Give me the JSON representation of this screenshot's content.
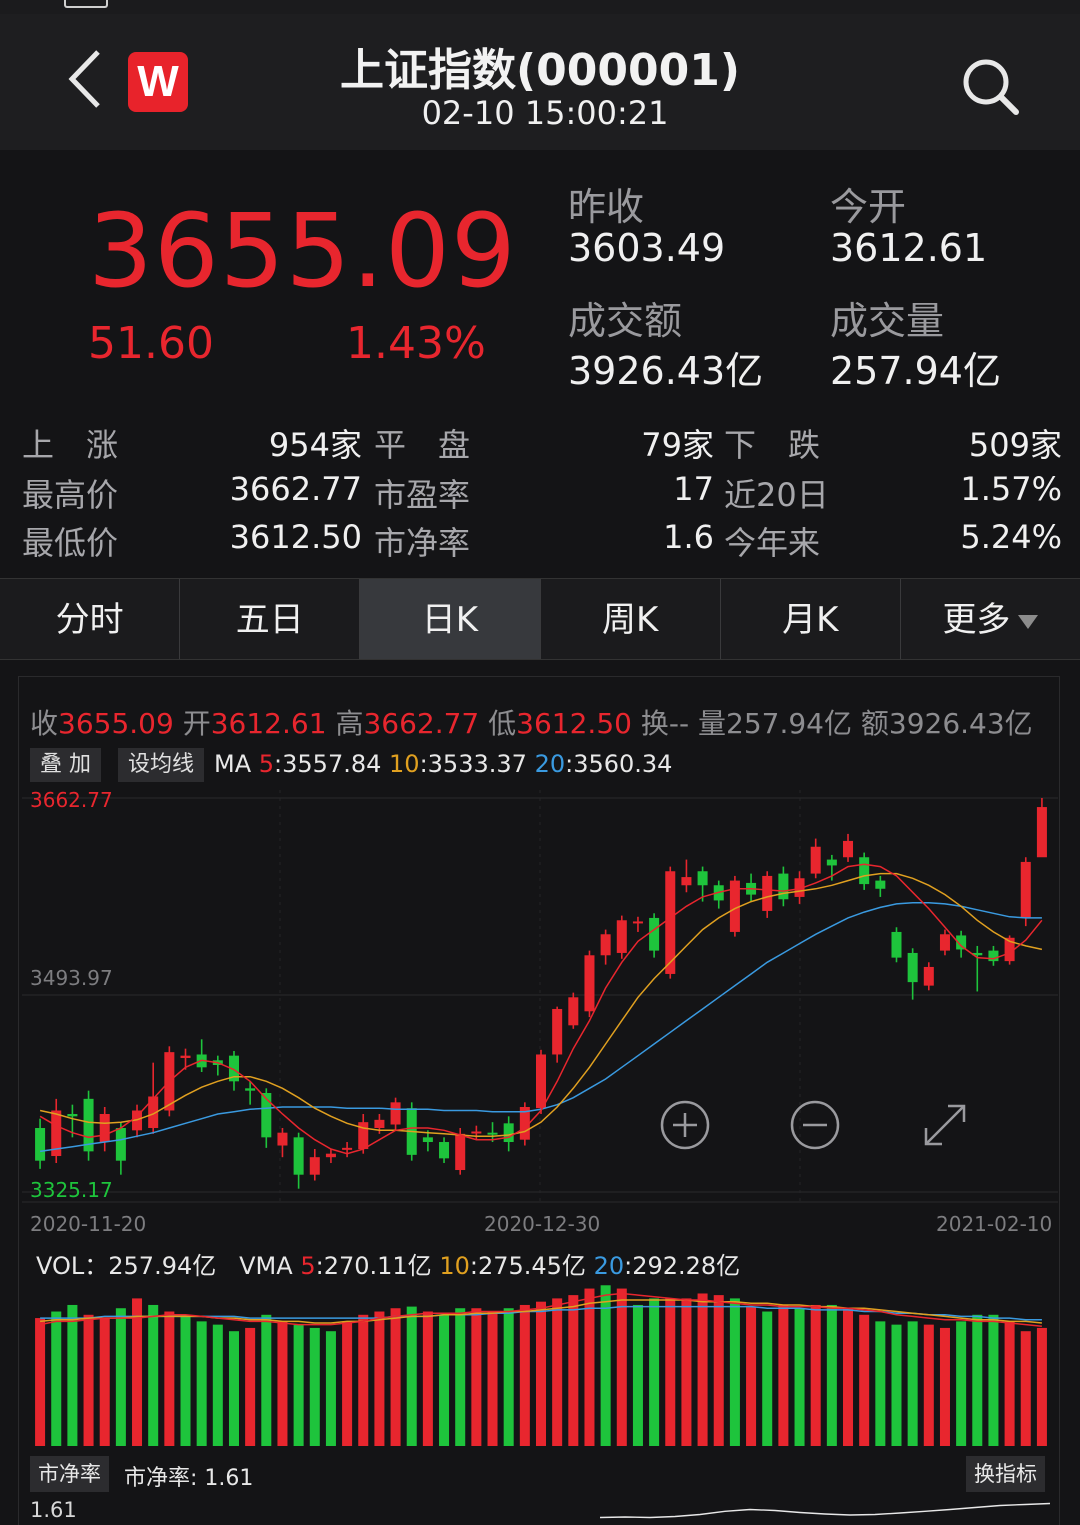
{
  "header": {
    "back_icon": "chevron-left-icon",
    "logo_text": "W",
    "title": "上证指数(000001)",
    "time": "02-10 15:00:21",
    "search_icon": "search-icon"
  },
  "quote": {
    "price": "3655.09",
    "change": "51.60",
    "change_pct": "1.43%",
    "prev_close_label": "昨收",
    "prev_close": "3603.49",
    "open_label": "今开",
    "open": "3612.61",
    "amount_label": "成交额",
    "amount": "3926.43亿",
    "volume_label": "成交量",
    "volume": "257.94亿",
    "up_color": "#e8262e"
  },
  "stats": [
    {
      "l1": "上　涨",
      "v1": "954家",
      "l2": "平　盘",
      "v2": "79家",
      "l3": "下　跌",
      "v3": "509家"
    },
    {
      "l1": "最高价",
      "v1": "3662.77",
      "l2": "市盈率",
      "v2": "17",
      "l3": "近20日",
      "v3": "1.57%"
    },
    {
      "l1": "最低价",
      "v1": "3612.50",
      "l2": "市净率",
      "v2": "1.6",
      "l3": "今年来",
      "v3": "5.24%"
    }
  ],
  "tabs": [
    "分时",
    "五日",
    "日K",
    "周K",
    "月K",
    "更多"
  ],
  "active_tab": "日K",
  "kline": {
    "ohlc": {
      "close_label": "收",
      "close": "3655.09",
      "open_label": "开",
      "open": "3612.61",
      "high_label": "高",
      "high": "3662.77",
      "low_label": "低",
      "low": "3612.50",
      "turnover_label": "换--",
      "vol_label": "量257.94亿",
      "amt_label": "额3926.43亿"
    },
    "overlay_btn": "叠 加",
    "ma_btn": "设均线",
    "ma_prefix": "MA",
    "ma5_k": "5",
    "ma5_v": ":3557.84",
    "ma10_k": "10",
    "ma10_v": ":3533.37",
    "ma20_k": "20",
    "ma20_v": ":3560.34",
    "y_high": "3662.77",
    "y_mid": "3493.97",
    "y_low": "3325.17",
    "dates": [
      "2020-11-20",
      "2020-12-30",
      "2021-02-10"
    ],
    "zoom_in_icon": "zoom-in-icon",
    "zoom_out_icon": "zoom-out-icon",
    "fullscreen_icon": "expand-icon"
  },
  "volume": {
    "prefix": "VOL：",
    "value": "257.94亿",
    "vma": "VMA",
    "vma5_k": "5",
    "vma5_v": ":270.11亿",
    "vma10_k": "10",
    "vma10_v": ":275.45亿",
    "vma20_k": "20",
    "vma20_v": ":292.28亿"
  },
  "indicator": {
    "chip": "市净率",
    "label": "市净率: 1.61",
    "switch_btn": "换指标",
    "axis": "1.61"
  },
  "colors": {
    "up": "#e8262e",
    "down": "#1ec43c",
    "ma5": "#e8262e",
    "ma10": "#e0a020",
    "ma20": "#3a9ae0"
  },
  "chart_data": {
    "type": "candlestick",
    "ylim": [
      3325.17,
      3662.77
    ],
    "candles": [
      {
        "o": 3380,
        "c": 3352,
        "h": 3388,
        "l": 3345
      },
      {
        "o": 3356,
        "c": 3395,
        "h": 3405,
        "l": 3350
      },
      {
        "o": 3392,
        "c": 3390,
        "h": 3400,
        "l": 3372
      },
      {
        "o": 3405,
        "c": 3360,
        "h": 3412,
        "l": 3352
      },
      {
        "o": 3368,
        "c": 3392,
        "h": 3398,
        "l": 3360
      },
      {
        "o": 3380,
        "c": 3352,
        "h": 3385,
        "l": 3340
      },
      {
        "o": 3378,
        "c": 3395,
        "h": 3400,
        "l": 3372
      },
      {
        "o": 3380,
        "c": 3407,
        "h": 3436,
        "l": 3375
      },
      {
        "o": 3395,
        "c": 3445,
        "h": 3450,
        "l": 3390
      },
      {
        "o": 3440,
        "c": 3442,
        "h": 3448,
        "l": 3430
      },
      {
        "o": 3443,
        "c": 3432,
        "h": 3456,
        "l": 3428
      },
      {
        "o": 3438,
        "c": 3434,
        "h": 3442,
        "l": 3425
      },
      {
        "o": 3442,
        "c": 3420,
        "h": 3446,
        "l": 3412
      },
      {
        "o": 3414,
        "c": 3412,
        "h": 3420,
        "l": 3400
      },
      {
        "o": 3410,
        "c": 3372,
        "h": 3414,
        "l": 3363
      },
      {
        "o": 3365,
        "c": 3376,
        "h": 3380,
        "l": 3355
      },
      {
        "o": 3372,
        "c": 3340,
        "h": 3376,
        "l": 3328
      },
      {
        "o": 3340,
        "c": 3355,
        "h": 3362,
        "l": 3335
      },
      {
        "o": 3355,
        "c": 3358,
        "h": 3362,
        "l": 3350
      },
      {
        "o": 3362,
        "c": 3363,
        "h": 3368,
        "l": 3355
      },
      {
        "o": 3362,
        "c": 3385,
        "h": 3392,
        "l": 3358
      },
      {
        "o": 3380,
        "c": 3387,
        "h": 3392,
        "l": 3375
      },
      {
        "o": 3383,
        "c": 3402,
        "h": 3406,
        "l": 3378
      },
      {
        "o": 3397,
        "c": 3357,
        "h": 3402,
        "l": 3352
      },
      {
        "o": 3372,
        "c": 3368,
        "h": 3378,
        "l": 3360
      },
      {
        "o": 3368,
        "c": 3354,
        "h": 3372,
        "l": 3350
      },
      {
        "o": 3344,
        "c": 3375,
        "h": 3380,
        "l": 3340
      },
      {
        "o": 3376,
        "c": 3377,
        "h": 3382,
        "l": 3370
      },
      {
        "o": 3376,
        "c": 3375,
        "h": 3385,
        "l": 3368
      },
      {
        "o": 3384,
        "c": 3368,
        "h": 3390,
        "l": 3360
      },
      {
        "o": 3370,
        "c": 3398,
        "h": 3402,
        "l": 3365
      },
      {
        "o": 3397,
        "c": 3443,
        "h": 3447,
        "l": 3392
      },
      {
        "o": 3443,
        "c": 3482,
        "h": 3484,
        "l": 3436
      },
      {
        "o": 3468,
        "c": 3492,
        "h": 3496,
        "l": 3465
      },
      {
        "o": 3480,
        "c": 3528,
        "h": 3532,
        "l": 3475
      },
      {
        "o": 3528,
        "c": 3546,
        "h": 3550,
        "l": 3520
      },
      {
        "o": 3530,
        "c": 3558,
        "h": 3562,
        "l": 3525
      },
      {
        "o": 3557,
        "c": 3557,
        "h": 3561,
        "l": 3548
      },
      {
        "o": 3560,
        "c": 3532,
        "h": 3564,
        "l": 3526
      },
      {
        "o": 3512,
        "c": 3600,
        "h": 3604,
        "l": 3508
      },
      {
        "o": 3588,
        "c": 3595,
        "h": 3610,
        "l": 3582
      },
      {
        "o": 3600,
        "c": 3588,
        "h": 3604,
        "l": 3574
      },
      {
        "o": 3588,
        "c": 3575,
        "h": 3592,
        "l": 3568
      },
      {
        "o": 3548,
        "c": 3592,
        "h": 3596,
        "l": 3544
      },
      {
        "o": 3590,
        "c": 3580,
        "h": 3598,
        "l": 3574
      },
      {
        "o": 3566,
        "c": 3596,
        "h": 3600,
        "l": 3560
      },
      {
        "o": 3598,
        "c": 3576,
        "h": 3604,
        "l": 3570
      },
      {
        "o": 3578,
        "c": 3594,
        "h": 3600,
        "l": 3572
      },
      {
        "o": 3598,
        "c": 3621,
        "h": 3628,
        "l": 3594
      },
      {
        "o": 3610,
        "c": 3605,
        "h": 3614,
        "l": 3592
      },
      {
        "o": 3612,
        "c": 3626,
        "h": 3632,
        "l": 3608
      },
      {
        "o": 3612,
        "c": 3589,
        "h": 3616,
        "l": 3584
      },
      {
        "o": 3592,
        "c": 3585,
        "h": 3596,
        "l": 3578
      },
      {
        "o": 3548,
        "c": 3526,
        "h": 3552,
        "l": 3522
      },
      {
        "o": 3530,
        "c": 3505,
        "h": 3534,
        "l": 3490
      },
      {
        "o": 3502,
        "c": 3518,
        "h": 3522,
        "l": 3498
      },
      {
        "o": 3532,
        "c": 3546,
        "h": 3550,
        "l": 3528
      },
      {
        "o": 3545,
        "c": 3533,
        "h": 3549,
        "l": 3526
      },
      {
        "o": 3530,
        "c": 3528,
        "h": 3536,
        "l": 3497
      },
      {
        "o": 3532,
        "c": 3523,
        "h": 3536,
        "l": 3519
      },
      {
        "o": 3523,
        "c": 3543,
        "h": 3545,
        "l": 3520
      },
      {
        "o": 3560,
        "c": 3608,
        "h": 3612,
        "l": 3553
      },
      {
        "o": 3612,
        "c": 3655,
        "h": 3662.77,
        "l": 3612.5
      }
    ],
    "ma5": [
      3390,
      3382,
      3376,
      3372,
      3374,
      3380,
      3390,
      3405,
      3420,
      3432,
      3438,
      3436,
      3430,
      3420,
      3405,
      3392,
      3380,
      3370,
      3362,
      3358,
      3362,
      3370,
      3378,
      3380,
      3380,
      3378,
      3374,
      3370,
      3370,
      3372,
      3380,
      3395,
      3420,
      3448,
      3472,
      3500,
      3522,
      3540,
      3550,
      3560,
      3570,
      3578,
      3582,
      3585,
      3585,
      3584,
      3583,
      3585,
      3590,
      3596,
      3604,
      3606,
      3604,
      3596,
      3582,
      3568,
      3552,
      3536,
      3526,
      3525,
      3530,
      3541,
      3558
    ],
    "ma10": [
      3395,
      3392,
      3388,
      3385,
      3384,
      3385,
      3387,
      3392,
      3400,
      3408,
      3415,
      3420,
      3424,
      3424,
      3420,
      3414,
      3406,
      3397,
      3390,
      3384,
      3380,
      3378,
      3378,
      3377,
      3376,
      3375,
      3374,
      3373,
      3373,
      3374,
      3377,
      3385,
      3398,
      3414,
      3432,
      3452,
      3472,
      3492,
      3508,
      3522,
      3536,
      3550,
      3560,
      3568,
      3574,
      3578,
      3581,
      3583,
      3585,
      3588,
      3592,
      3596,
      3598,
      3598,
      3594,
      3588,
      3580,
      3570,
      3558,
      3548,
      3540,
      3536,
      3533
    ],
    "ma20": [
      3360,
      3362,
      3364,
      3366,
      3368,
      3370,
      3373,
      3376,
      3380,
      3384,
      3388,
      3392,
      3394,
      3396,
      3397,
      3398,
      3398,
      3398,
      3398,
      3397,
      3397,
      3397,
      3396,
      3396,
      3396,
      3395,
      3395,
      3395,
      3394,
      3394,
      3394,
      3396,
      3400,
      3406,
      3414,
      3422,
      3432,
      3442,
      3452,
      3462,
      3472,
      3482,
      3492,
      3502,
      3512,
      3522,
      3530,
      3538,
      3546,
      3553,
      3560,
      3565,
      3569,
      3572,
      3573,
      3573,
      3572,
      3570,
      3567,
      3564,
      3561,
      3560,
      3560
    ],
    "vol": [
      0.78,
      0.82,
      0.86,
      0.8,
      0.78,
      0.84,
      0.9,
      0.86,
      0.82,
      0.8,
      0.76,
      0.74,
      0.7,
      0.72,
      0.8,
      0.76,
      0.74,
      0.72,
      0.7,
      0.76,
      0.8,
      0.82,
      0.84,
      0.85,
      0.82,
      0.8,
      0.84,
      0.84,
      0.82,
      0.84,
      0.86,
      0.88,
      0.9,
      0.92,
      0.96,
      0.98,
      0.96,
      0.86,
      0.9,
      0.9,
      0.9,
      0.93,
      0.92,
      0.9,
      0.85,
      0.82,
      0.86,
      0.84,
      0.86,
      0.86,
      0.84,
      0.8,
      0.76,
      0.74,
      0.76,
      0.74,
      0.72,
      0.76,
      0.8,
      0.8,
      0.76,
      0.7,
      0.72
    ],
    "vol_up": [
      true,
      false,
      false,
      true,
      true,
      false,
      true,
      false,
      true,
      false,
      false,
      false,
      false,
      true,
      false,
      true,
      false,
      false,
      false,
      true,
      true,
      true,
      true,
      false,
      true,
      false,
      false,
      true,
      true,
      false,
      true,
      true,
      true,
      true,
      true,
      false,
      true,
      false,
      false,
      true,
      true,
      true,
      true,
      false,
      true,
      false,
      true,
      false,
      true,
      false,
      true,
      true,
      false,
      false,
      false,
      true,
      true,
      false,
      false,
      false,
      true,
      true,
      true
    ],
    "vma5": [
      0.74,
      0.76,
      0.76,
      0.77,
      0.78,
      0.78,
      0.78,
      0.79,
      0.8,
      0.8,
      0.79,
      0.78,
      0.77,
      0.76,
      0.76,
      0.75,
      0.74,
      0.74,
      0.74,
      0.75,
      0.76,
      0.78,
      0.79,
      0.8,
      0.81,
      0.81,
      0.81,
      0.82,
      0.82,
      0.82,
      0.83,
      0.84,
      0.86,
      0.88,
      0.9,
      0.92,
      0.93,
      0.92,
      0.91,
      0.9,
      0.89,
      0.89,
      0.88,
      0.87,
      0.86,
      0.86,
      0.85,
      0.85,
      0.85,
      0.84,
      0.84,
      0.83,
      0.82,
      0.8,
      0.79,
      0.78,
      0.77,
      0.77,
      0.76,
      0.76,
      0.75,
      0.74,
      0.73
    ],
    "vma10": [
      0.76,
      0.77,
      0.77,
      0.78,
      0.78,
      0.78,
      0.79,
      0.79,
      0.79,
      0.79,
      0.79,
      0.78,
      0.78,
      0.77,
      0.77,
      0.76,
      0.76,
      0.75,
      0.75,
      0.76,
      0.76,
      0.77,
      0.78,
      0.79,
      0.79,
      0.8,
      0.8,
      0.81,
      0.81,
      0.82,
      0.82,
      0.83,
      0.84,
      0.85,
      0.87,
      0.88,
      0.89,
      0.89,
      0.89,
      0.89,
      0.89,
      0.88,
      0.88,
      0.88,
      0.87,
      0.87,
      0.86,
      0.86,
      0.85,
      0.85,
      0.84,
      0.84,
      0.83,
      0.82,
      0.81,
      0.8,
      0.79,
      0.78,
      0.77,
      0.77,
      0.76,
      0.76,
      0.75
    ],
    "vma20": [
      0.78,
      0.78,
      0.78,
      0.78,
      0.79,
      0.79,
      0.79,
      0.79,
      0.79,
      0.79,
      0.79,
      0.79,
      0.79,
      0.78,
      0.78,
      0.78,
      0.78,
      0.78,
      0.78,
      0.78,
      0.78,
      0.78,
      0.79,
      0.79,
      0.79,
      0.8,
      0.8,
      0.8,
      0.81,
      0.81,
      0.82,
      0.82,
      0.83,
      0.83,
      0.84,
      0.84,
      0.85,
      0.85,
      0.85,
      0.85,
      0.85,
      0.85,
      0.85,
      0.85,
      0.85,
      0.84,
      0.84,
      0.84,
      0.83,
      0.83,
      0.83,
      0.82,
      0.82,
      0.81,
      0.81,
      0.8,
      0.8,
      0.79,
      0.79,
      0.78,
      0.78,
      0.77,
      0.77
    ],
    "pb_line": [
      0.3,
      0.32,
      0.3,
      0.34,
      0.42,
      0.55,
      0.62,
      0.58,
      0.5,
      0.44,
      0.4,
      0.42,
      0.48,
      0.55,
      0.62,
      0.7,
      0.78,
      0.82,
      0.86
    ]
  }
}
